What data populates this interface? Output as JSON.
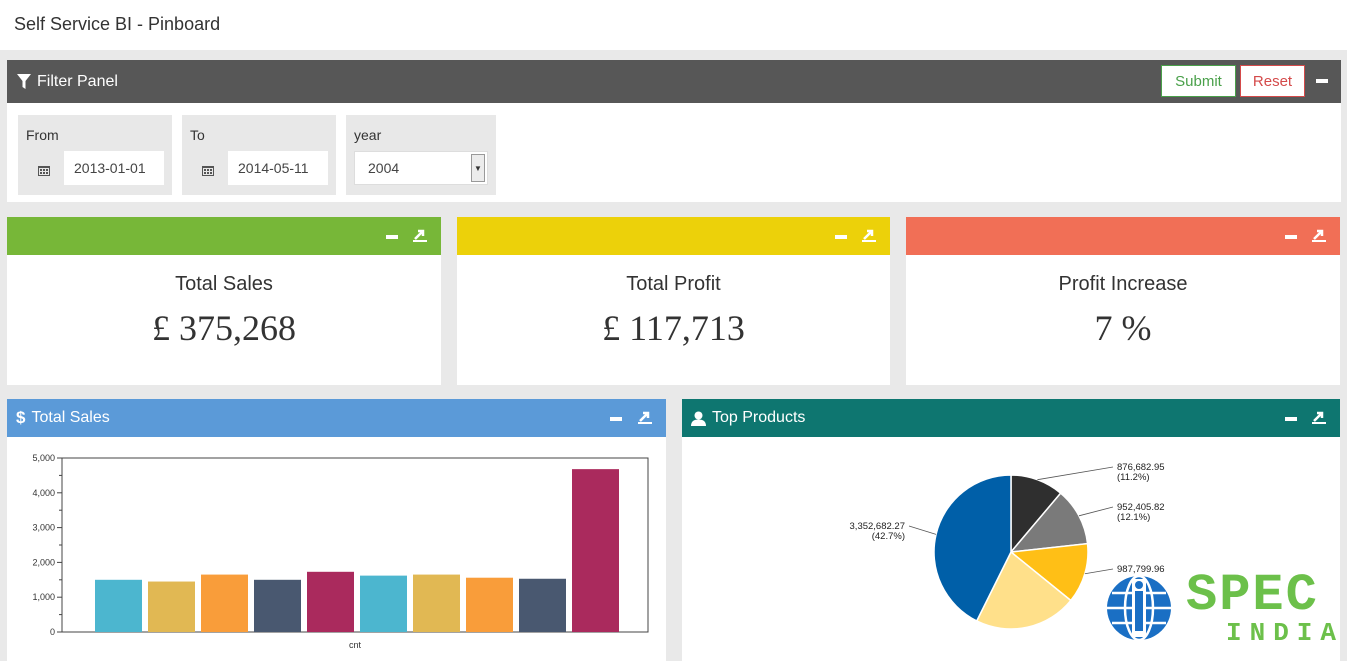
{
  "app": {
    "title": "Self Service BI - Pinboard"
  },
  "filter_panel": {
    "title": "Filter Panel",
    "submit_label": "Submit",
    "reset_label": "Reset",
    "from": {
      "label": "From",
      "value": "2013-01-01"
    },
    "to": {
      "label": "To",
      "value": "2014-05-11"
    },
    "year": {
      "label": "year",
      "value": "2004"
    }
  },
  "kpis": [
    {
      "title": "Total Sales",
      "value": "£ 375,268",
      "color": "#77b738"
    },
    {
      "title": "Total Profit",
      "value": "£ 117,713",
      "color": "#ecd10a"
    },
    {
      "title": "Profit Increase",
      "value": "7 %",
      "color": "#f16f56"
    }
  ],
  "sales_panel": {
    "title": "Total Sales",
    "icon": "dollar-icon",
    "color": "#5b9ad8"
  },
  "products_panel": {
    "title": "Top Products",
    "icon": "user-icon",
    "color": "#0e7670"
  },
  "chart_data": [
    {
      "type": "bar",
      "xlabel": "cnt",
      "ylim": [
        0,
        5000
      ],
      "yticks": [
        "0",
        "1,000",
        "2,000",
        "3,000",
        "4,000",
        "5,000"
      ],
      "values": [
        1500,
        1450,
        1650,
        1500,
        1730,
        1620,
        1650,
        1560,
        1530,
        4680
      ],
      "colors": [
        "#4cb6cf",
        "#e1b853",
        "#f99d3a",
        "#495870",
        "#aa2a5d",
        "#4cb6cf",
        "#e1b853",
        "#f99d3a",
        "#495870",
        "#aa2a5d"
      ]
    },
    {
      "type": "pie",
      "slices": [
        {
          "value": 876682.95,
          "label": "876,682.95",
          "pct": "(11.2%)",
          "color": "#2f2f2f"
        },
        {
          "value": 952405.82,
          "label": "952,405.82",
          "pct": "(12.1%)",
          "color": "#7a7a7a"
        },
        {
          "value": 987799.96,
          "label": "987,799.96",
          "pct": "",
          "color": "#ffbf16"
        },
        {
          "value": 1690000,
          "label": "",
          "pct": "",
          "color": "#ffe08a"
        },
        {
          "value": 3352682.27,
          "label": "3,352,682.27",
          "pct": "(42.7%)",
          "color": "#005fa8"
        }
      ]
    }
  ],
  "watermark": {
    "line1": "SPEC",
    "line2": "INDIA"
  }
}
